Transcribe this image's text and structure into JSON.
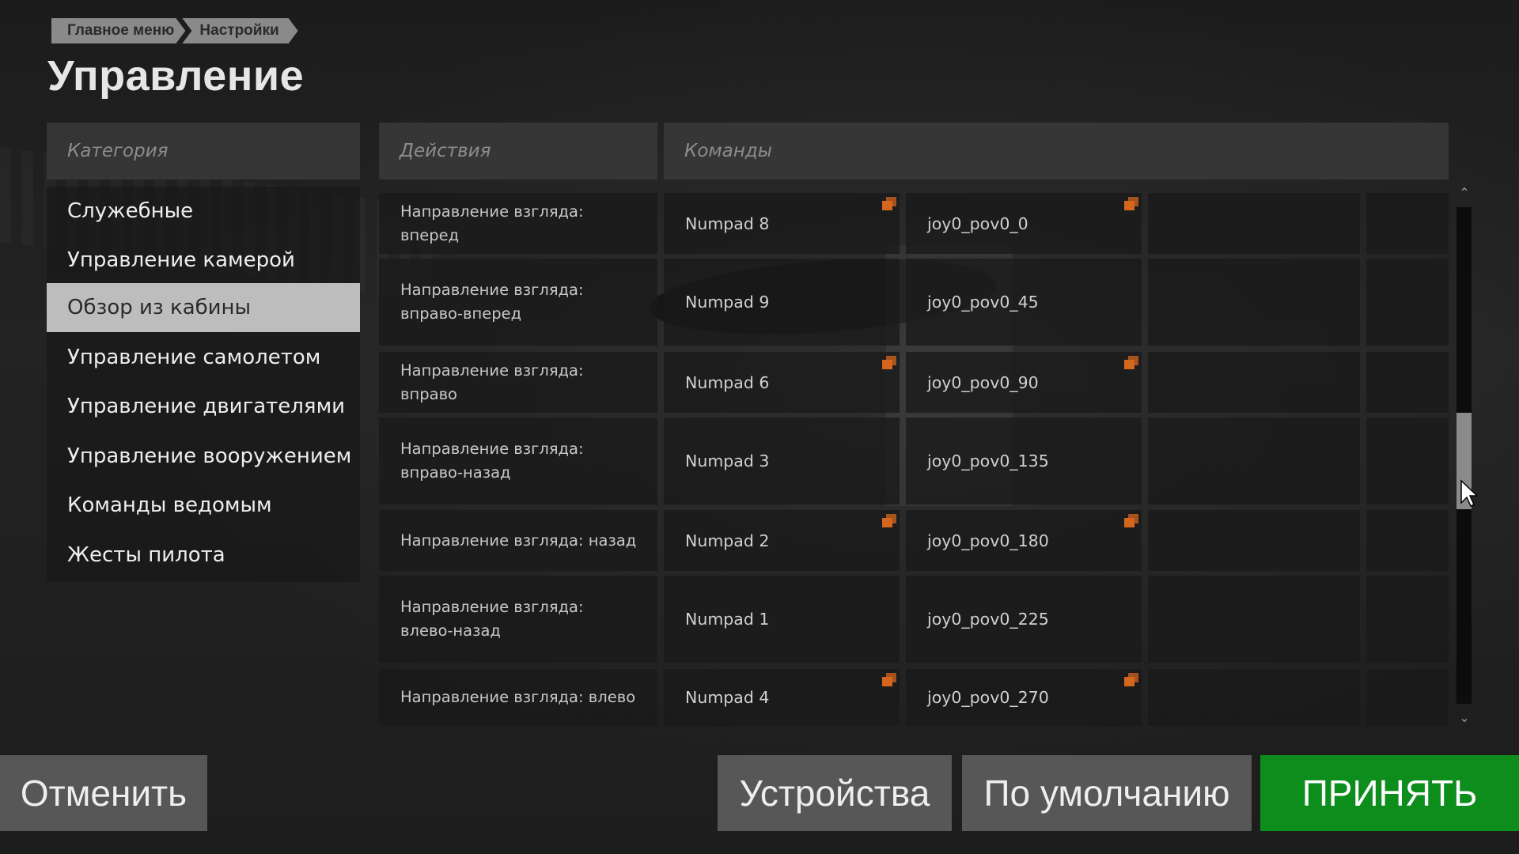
{
  "breadcrumb": [
    "Главное меню",
    "Настройки"
  ],
  "page_title": "Управление",
  "headers": {
    "category": "Категория",
    "actions": "Действия",
    "commands": "Команды"
  },
  "categories": [
    {
      "label": "Служебные"
    },
    {
      "label": "Управление камерой"
    },
    {
      "label": "Обзор из кабины",
      "selected": true
    },
    {
      "label": "Управление самолетом"
    },
    {
      "label": "Управление двигателями"
    },
    {
      "label": "Управление вооружением"
    },
    {
      "label": "Команды ведомым"
    },
    {
      "label": "Жесты пилота"
    }
  ],
  "rows": [
    {
      "action": "Направление взгляда: вперед",
      "cmd1": "Numpad 8",
      "cmd2": "joy0_pov0_0",
      "copy_icons": true
    },
    {
      "action": "Направление взгляда: вправо-вперед",
      "cmd1": "Numpad 9",
      "cmd2": "joy0_pov0_45",
      "copy_icons": false
    },
    {
      "action": "Направление взгляда: вправо",
      "cmd1": "Numpad 6",
      "cmd2": "joy0_pov0_90",
      "copy_icons": true
    },
    {
      "action": "Направление взгляда: вправо-назад",
      "cmd1": "Numpad 3",
      "cmd2": "joy0_pov0_135",
      "copy_icons": false
    },
    {
      "action": "Направление взгляда: назад",
      "cmd1": "Numpad 2",
      "cmd2": "joy0_pov0_180",
      "copy_icons": true
    },
    {
      "action": "Направление взгляда: влево-назад",
      "cmd1": "Numpad 1",
      "cmd2": "joy0_pov0_225",
      "copy_icons": false
    },
    {
      "action": "Направление взгляда: влево",
      "cmd1": "Numpad 4",
      "cmd2": "joy0_pov0_270",
      "copy_icons": true
    }
  ],
  "icons": {
    "copy": "copy-icon",
    "scroll_up": "chevron-up-icon",
    "scroll_down": "chevron-down-icon",
    "cursor": "mouse-cursor-icon"
  },
  "colors": {
    "accent_copy_icon": "#d4661e",
    "accept_button": "#0c8d1c",
    "selected_category": "#bdbdbd"
  },
  "buttons": {
    "cancel": "Отменить",
    "devices": "Устройства",
    "default": "По умолчанию",
    "accept": "ПРИНЯТЬ"
  }
}
